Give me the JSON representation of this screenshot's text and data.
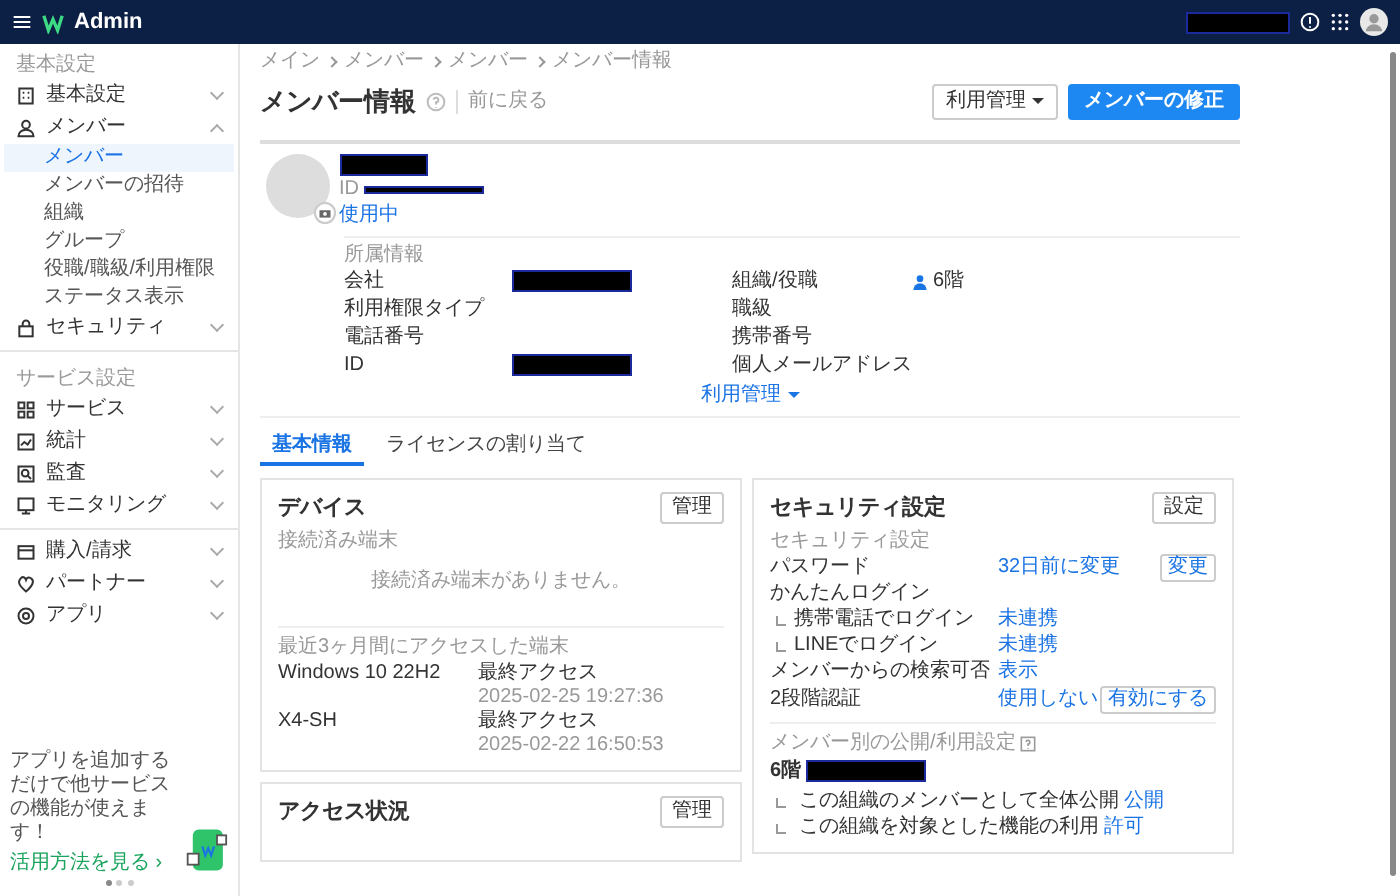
{
  "top_bar": {
    "title": "Admin",
    "account_redacted": true
  },
  "sidebar": {
    "sections": [
      {
        "heading": "基本設定",
        "items": [
          {
            "label": "基本設定",
            "expanded": false
          },
          {
            "label": "メンバー",
            "expanded": true,
            "children": [
              {
                "label": "メンバー",
                "selected": true
              },
              {
                "label": "メンバーの招待",
                "selected": false
              },
              {
                "label": "組織",
                "selected": false
              },
              {
                "label": "グループ",
                "selected": false
              },
              {
                "label": "役職/職級/利用権限",
                "selected": false
              },
              {
                "label": "ステータス表示",
                "selected": false
              }
            ]
          },
          {
            "label": "セキュリティ",
            "expanded": false
          }
        ]
      },
      {
        "heading": "サービス設定",
        "items": [
          {
            "label": "サービス",
            "expanded": false
          },
          {
            "label": "統計",
            "expanded": false
          },
          {
            "label": "監査",
            "expanded": false
          },
          {
            "label": "モニタリング",
            "expanded": false
          }
        ]
      },
      {
        "items": [
          {
            "label": "購入/請求",
            "expanded": false
          },
          {
            "label": "パートナー",
            "expanded": false
          },
          {
            "label": "アプリ",
            "expanded": false
          }
        ]
      }
    ],
    "promo": {
      "text": "アプリを追加するだけで他サービスの機能が使えます！",
      "link": "活用方法を見る ›",
      "dots": [
        {
          "selected": true
        },
        {
          "selected": false
        },
        {
          "selected": false
        }
      ]
    }
  },
  "breadcrumb": [
    "メイン",
    "メンバー",
    "メンバー",
    "メンバー情報"
  ],
  "header": {
    "title": "メンバー情報",
    "back": "前に戻る",
    "buttons": [
      {
        "label": "利用管理",
        "kind": "dropdown"
      },
      {
        "label": "メンバーの修正",
        "kind": "primary"
      }
    ]
  },
  "profile": {
    "name_redacted": true,
    "id_label": "ID",
    "id_redacted": true,
    "status": "使用中"
  },
  "affiliation": {
    "heading": "所属情報",
    "fields": [
      {
        "label": "会社",
        "redacted": true
      },
      {
        "label": "組織/役職",
        "value": "6階",
        "kind": "org"
      },
      {
        "label": "利用権限タイプ"
      },
      {
        "label": "職級"
      },
      {
        "label": "電話番号"
      },
      {
        "label": "携帯番号"
      },
      {
        "label": "ID",
        "redacted": true
      },
      {
        "label": "個人メールアドレス"
      }
    ],
    "more_link": "利用管理"
  },
  "tabs": [
    {
      "label": "基本情報",
      "selected": true
    },
    {
      "label": "ライセンスの割り当て",
      "selected": false
    }
  ],
  "device_card": {
    "title": "デバイス",
    "button": "管理",
    "connected_heading": "接続済み端末",
    "empty_text": "接続済み端末がありません。",
    "recent_heading": "最近3ヶ月間にアクセスした端末",
    "devices": [
      {
        "name": "Windows 10 22H2",
        "label": "最終アクセス",
        "time": "2025-02-25 19:27:36"
      },
      {
        "name": "X4-SH",
        "label": "最終アクセス",
        "time": "2025-02-22 16:50:53"
      }
    ]
  },
  "access_card": {
    "title": "アクセス状況",
    "button": "管理"
  },
  "security_card": {
    "title": "セキュリティ設定",
    "button": "設定",
    "heading": "セキュリティ設定",
    "rows": [
      {
        "label": "パスワード",
        "value": "32日前に変更",
        "button": "変更"
      },
      {
        "label": "かんたんログイン",
        "children": [
          {
            "label": "携帯電話でログイン",
            "value": "未連携"
          },
          {
            "label": "LINEでログイン",
            "value": "未連携"
          }
        ]
      },
      {
        "label": "メンバーからの検索可否",
        "value": "表示"
      },
      {
        "label": "2段階認証",
        "value": "使用しない",
        "button": "有効にする"
      }
    ],
    "public": {
      "heading": "メンバー別の公開/利用設定",
      "org": "6階",
      "org_redacted": true,
      "items": [
        {
          "label": "この組織のメンバーとして全体公開",
          "value": "公開"
        },
        {
          "label": "この組織を対象とした機能の利用",
          "value": "許可"
        }
      ]
    }
  }
}
